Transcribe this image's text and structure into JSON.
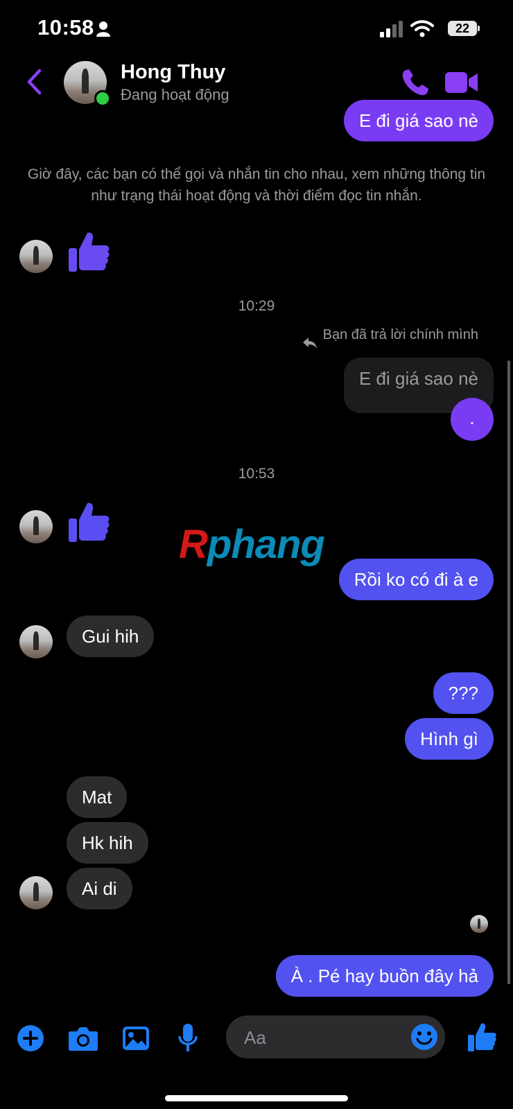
{
  "status_bar": {
    "time": "10:58",
    "battery": "22"
  },
  "header": {
    "name": "Hong Thuy",
    "status": "Đang hoạt động"
  },
  "system_note": "Giờ đây, các bạn có thể gọi và nhắn tin cho nhau, xem những thông tin như trạng thái hoạt động và thời điểm đọc tin nhắn.",
  "messages": {
    "top_outgoing": "E đi giá sao nè",
    "time_1": "10:29",
    "reply_label": "Bạn đã trả lời chính mình",
    "reply_quote": "E đi giá sao nè",
    "dot": ".",
    "time_2": "10:53",
    "out_1": "Rồi ko có đi à e",
    "in_1": "Gui hih",
    "out_2": "???",
    "out_3": "Hình gì",
    "in_2": "Mat",
    "in_3": "Hk hih",
    "in_4": "Ai di",
    "out_4": "À . Pé hay buồn đây hả"
  },
  "watermark": {
    "r": "R",
    "rest": "phang"
  },
  "composer": {
    "placeholder": "Aa"
  },
  "colors": {
    "accent": "#7a3cf3",
    "outgoing": "#5252f0",
    "incoming": "#2c2c2e",
    "icon_blue": "#1e7cf5"
  }
}
